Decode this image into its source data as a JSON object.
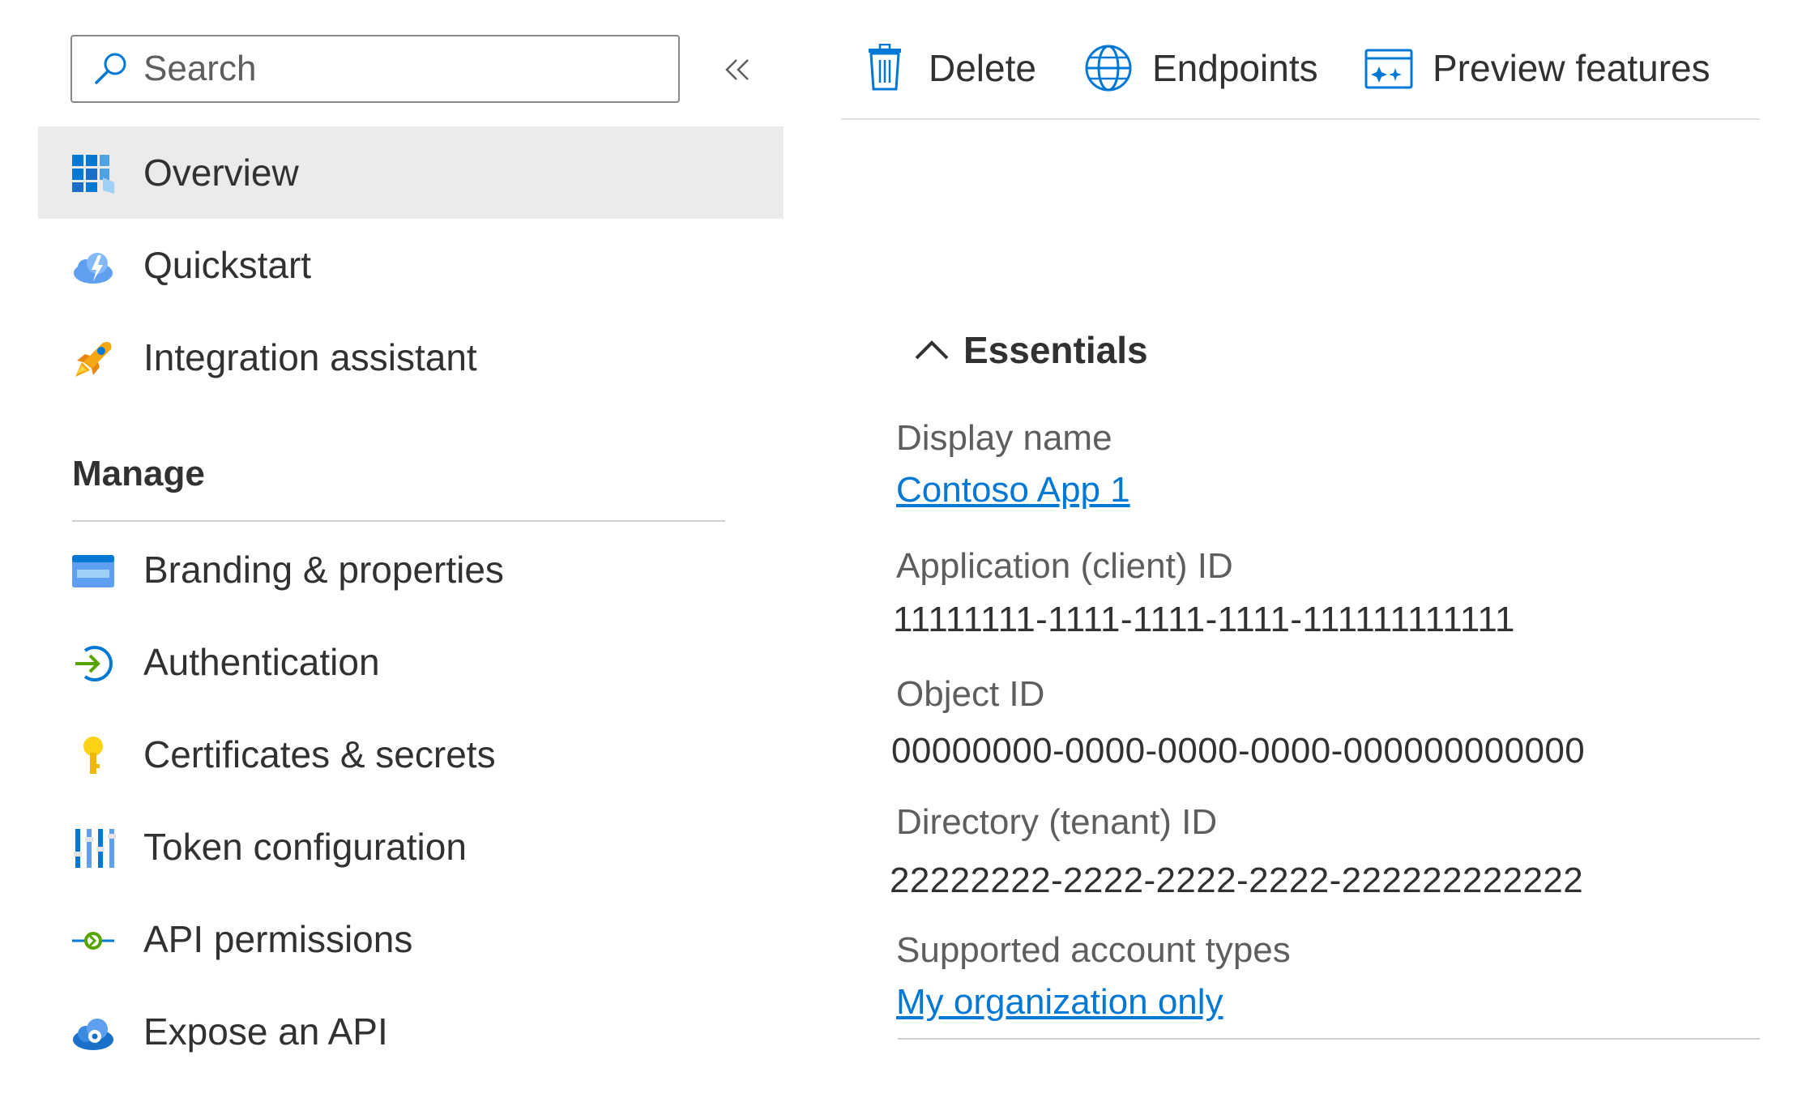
{
  "sidebar": {
    "search": {
      "placeholder": "Search",
      "value": ""
    },
    "items": [
      {
        "label": "Overview",
        "icon": "overview-icon",
        "selected": true
      },
      {
        "label": "Quickstart",
        "icon": "quickstart-cloud-icon"
      },
      {
        "label": "Integration assistant",
        "icon": "rocket-icon"
      }
    ],
    "manage": {
      "header": "Manage",
      "items": [
        {
          "label": "Branding & properties",
          "icon": "branding-icon"
        },
        {
          "label": "Authentication",
          "icon": "authentication-icon"
        },
        {
          "label": "Certificates & secrets",
          "icon": "key-icon"
        },
        {
          "label": "Token configuration",
          "icon": "token-configuration-icon"
        },
        {
          "label": "API permissions",
          "icon": "api-permissions-icon"
        },
        {
          "label": "Expose an API",
          "icon": "expose-api-cloud-icon"
        }
      ]
    }
  },
  "toolbar": {
    "delete_label": "Delete",
    "endpoints_label": "Endpoints",
    "preview_label": "Preview features"
  },
  "essentials": {
    "title": "Essentials",
    "display_name": {
      "label": "Display name",
      "value": "Contoso App 1"
    },
    "client_id": {
      "label": "Application (client) ID",
      "value": "11111111-1111-1111-1111-111111111111"
    },
    "object_id": {
      "label": "Object ID",
      "value": "00000000-0000-0000-0000-000000000000"
    },
    "tenant_id": {
      "label": "Directory (tenant) ID",
      "value": "22222222-2222-2222-2222-222222222222"
    },
    "account_types": {
      "label": "Supported account types",
      "value": "My organization only"
    }
  },
  "colors": {
    "accent": "#0078d4",
    "selected_background": "#edebe9",
    "text": "#323130",
    "secondary_text": "#605e5c"
  }
}
